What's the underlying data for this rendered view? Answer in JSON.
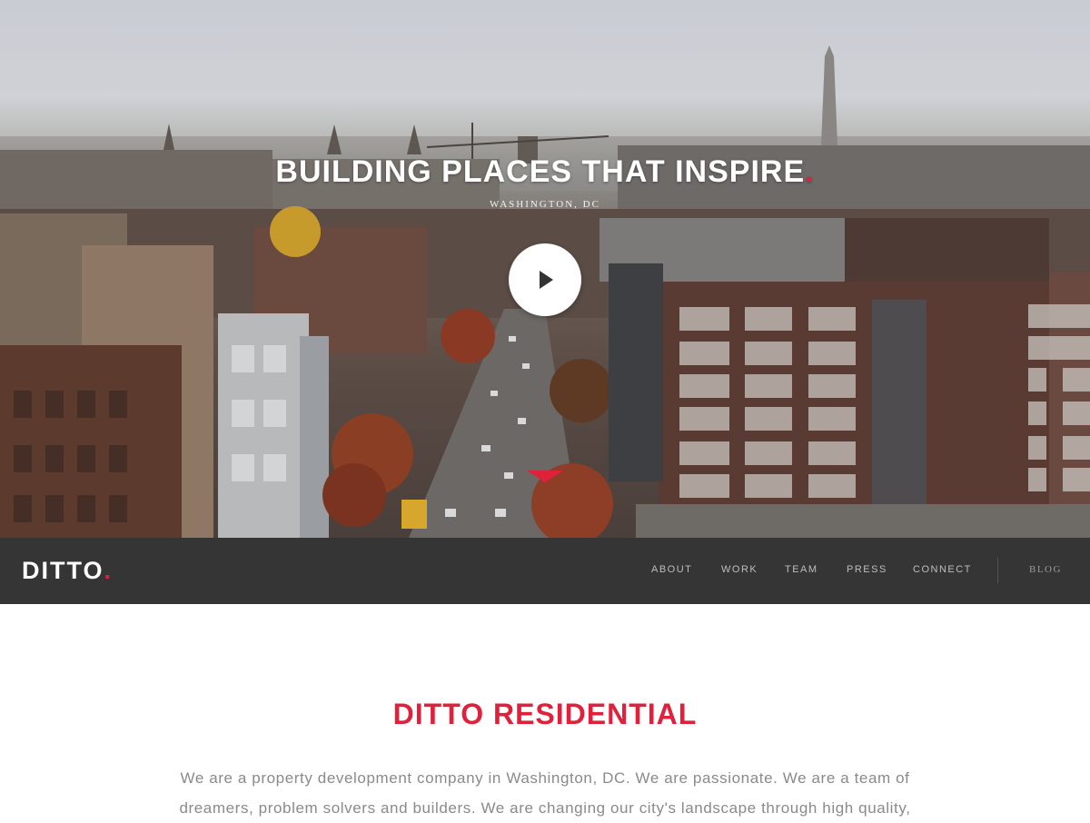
{
  "hero": {
    "title": "BUILDING PLACES THAT INSPIRE",
    "title_dot": ".",
    "subtitle": "WASHINGTON, DC",
    "play_icon": "play-icon",
    "scroll_icon": "chevron-down-icon"
  },
  "nav": {
    "logo": "DITTO",
    "logo_dot": ".",
    "links": [
      "ABOUT",
      "WORK",
      "TEAM",
      "PRESS",
      "CONNECT"
    ],
    "blog": "BLOG"
  },
  "intro": {
    "title": "DITTO RESIDENTIAL",
    "text": "We are a property development company in Washington, DC. We are passionate. We are a team of dreamers, problem solvers and builders. We are changing our city's landscape through high quality,"
  },
  "colors": {
    "accent": "#e0213c",
    "nav_background": "#353535",
    "body_text": "#8a8a8a"
  }
}
